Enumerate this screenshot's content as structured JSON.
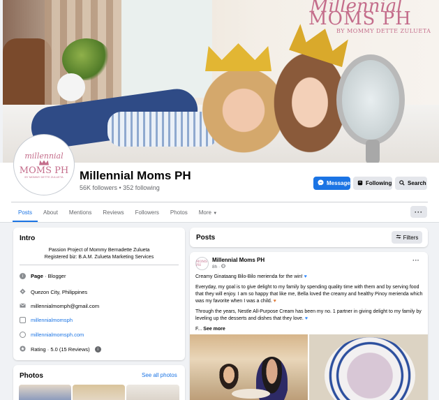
{
  "cover": {
    "brand_script": "Millennial",
    "brand_title": "MOMS PH",
    "brand_tagline": "BY MOMMY DETTE ZULUETA"
  },
  "profile": {
    "avatar_script": "millennial",
    "avatar_title": "MOMS PH",
    "avatar_tagline": "BY MOMMY DETTE ZULUETA",
    "name": "Millennial Moms PH",
    "stats": "56K followers • 352 following"
  },
  "actions": {
    "message": "Message",
    "following": "Following",
    "search": "Search"
  },
  "tabs": [
    {
      "label": "Posts"
    },
    {
      "label": "About"
    },
    {
      "label": "Mentions"
    },
    {
      "label": "Reviews"
    },
    {
      "label": "Followers"
    },
    {
      "label": "Photos"
    },
    {
      "label": "More"
    }
  ],
  "more_dots": "···",
  "intro": {
    "title": "Intro",
    "bio_line1": "Passion Project of Mommy Bernadette Zulueta",
    "bio_line2": "Registered biz: B.A.M. Zulueta Marketing Services",
    "page_label": "Page",
    "page_category": " · Blogger",
    "location": "Quezon City, Philippines",
    "email": "millennialmomph@gmail.com",
    "instagram": "millennialmomsph",
    "website": "millennialmomsph.com",
    "rating": "Rating · 5.0 (15 Reviews)"
  },
  "photos": {
    "title": "Photos",
    "see_all": "See all photos"
  },
  "posts": {
    "title": "Posts",
    "filters": "Filters"
  },
  "post": {
    "avatar_text": "MOMS PH",
    "author": "Millennial Moms PH",
    "time": "8h · ",
    "line1": "Creamy Ginataang Bilo-Bilo merienda for the win! ",
    "para1": "Everyday, my goal is to give delight to my family by spending quality time with them and by serving food that they will enjoy. I am so happy that like me, Bella loved the creamy and healthy Pinoy merienda which was my favorite when I was a child. ",
    "para2": "Through the years, Nestle All-Purpose Cream has been my no. 1 partner in giving delight to my family by leveling up the desserts and dishes that they love. ",
    "truncated": "F... ",
    "see_more": "See more"
  },
  "colors": {
    "accent": "#1b74e4",
    "brand_pink": "#c46d8b",
    "background": "#f0f2f5"
  }
}
